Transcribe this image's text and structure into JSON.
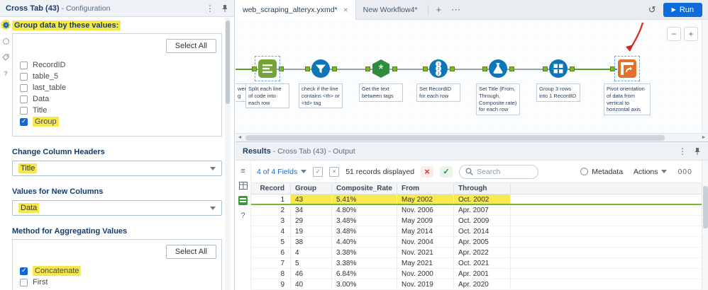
{
  "icons": {
    "kebab": "⋮",
    "close": "×",
    "plus": "+",
    "more": "⋯",
    "run_play": "▶",
    "history": "↺",
    "zoom_in": "+",
    "zoom_out": "−",
    "hamburger": "≡",
    "question": "?",
    "red_x": "×",
    "green_check": "✓",
    "left_arrow": "◄",
    "right_arrow": "►"
  },
  "colors": {
    "highlight_yellow": "#f7e84a",
    "accent_blue": "#1268d2",
    "run_button_blue": "#0f6ddb",
    "tool_green": "#74a338",
    "tool_blue": "#0e76b7",
    "tool_orange": "#e4712a",
    "anchor_green": "#7cb82f",
    "error_red": "#d93025",
    "success_green": "#1e8e3e",
    "row_select_green": "#76b82a"
  },
  "config": {
    "title_bold": "Cross Tab (43)",
    "title_rest": "- Configuration",
    "group_by_label": "Group data by these values:",
    "select_all": "Select All",
    "group_items": [
      "RecordID",
      "table_5",
      "last_table",
      "Data",
      "Title",
      "Group"
    ],
    "change_headers_label": "Change Column Headers",
    "change_headers_value": "Title",
    "new_columns_label": "Values for New Columns",
    "new_columns_value": "Data",
    "method_label": "Method for Aggregating Values",
    "method_select_all": "Select All",
    "method_items": [
      "Concatenate",
      "First"
    ]
  },
  "tabbar": {
    "tab1": "web_scraping_alteryx.yxmd*",
    "tab2": "New Workflow4*",
    "run": "Run"
  },
  "canvas": {
    "clipped_annotation": "ween\ng",
    "annotations": [
      "Split each line of code into each row",
      "check if the line contains <th> or <td> tag",
      "Get the text between tags",
      "Set RecordID for each row",
      "Set Title (From, Through, Composite rate) for each row",
      "Group 3 rows into 1 RecordID",
      "Pivot orientation of data from vertical to horizontal axis"
    ]
  },
  "results": {
    "title_bold": "Results",
    "title_rest": "- Cross Tab (43) - Output",
    "fields_summary": "4 of 4 Fields",
    "records_displayed": "51 records displayed",
    "search_placeholder": "Search",
    "metadata_label": "Metadata",
    "actions_label": "Actions",
    "counter": "000",
    "columns": [
      "Record",
      "Group",
      "Composite_Rate",
      "From",
      "Through"
    ],
    "rows": [
      [
        "1",
        "43",
        "5.41%",
        "May 2002",
        "Oct. 2002"
      ],
      [
        "2",
        "34",
        "4.80%",
        "Nov. 2006",
        "Apr. 2007"
      ],
      [
        "3",
        "29",
        "3.48%",
        "May 2009",
        "Oct. 2009"
      ],
      [
        "4",
        "19",
        "3.48%",
        "May 2014",
        "Oct. 2014"
      ],
      [
        "5",
        "38",
        "4.40%",
        "Nov. 2004",
        "Apr. 2005"
      ],
      [
        "6",
        "4",
        "3.38%",
        "Nov. 2021",
        "Apr. 2022"
      ],
      [
        "7",
        "5",
        "3.38%",
        "May 2021",
        "Oct. 2021"
      ],
      [
        "8",
        "46",
        "6.84%",
        "Nov. 2000",
        "Apr. 2001"
      ],
      [
        "9",
        "40",
        "3.00%",
        "Nov. 2019",
        "Apr. 2020"
      ]
    ]
  }
}
